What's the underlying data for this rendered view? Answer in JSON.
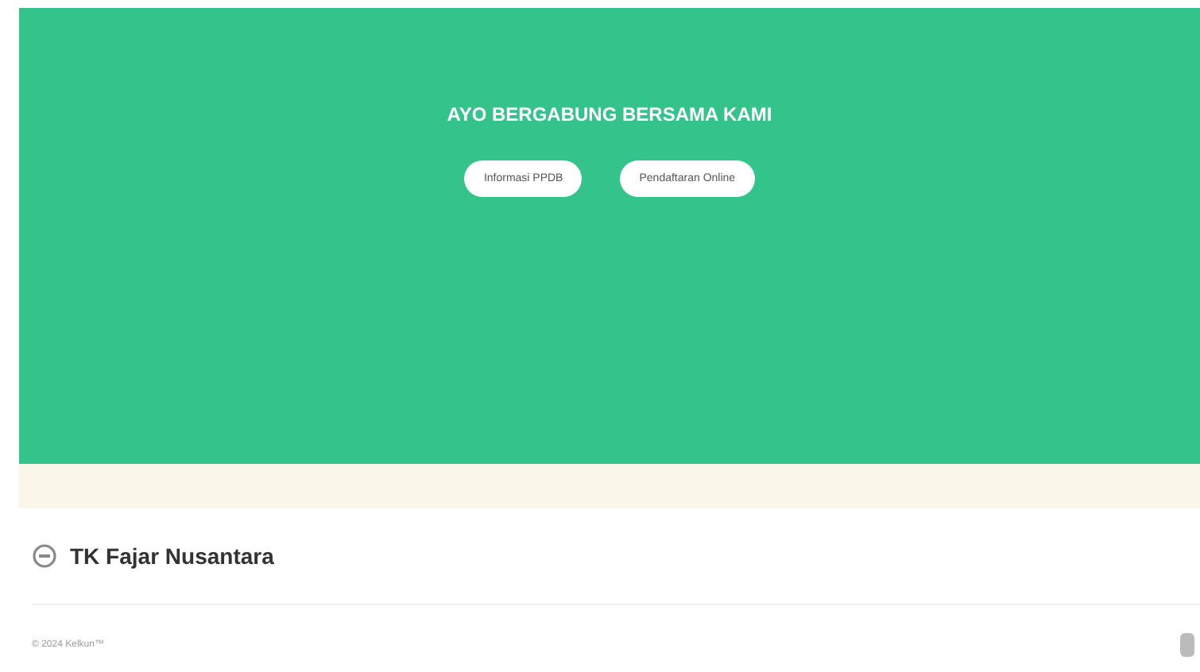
{
  "banner": {
    "heading": "AYO BERGABUNG BERSAMA KAMI",
    "buttons": [
      "Informasi PPDB",
      "Pendaftaran Online"
    ]
  },
  "footer": {
    "brand": "TK Fajar Nusantara",
    "copyright": "© 2024 Kelkun™"
  }
}
